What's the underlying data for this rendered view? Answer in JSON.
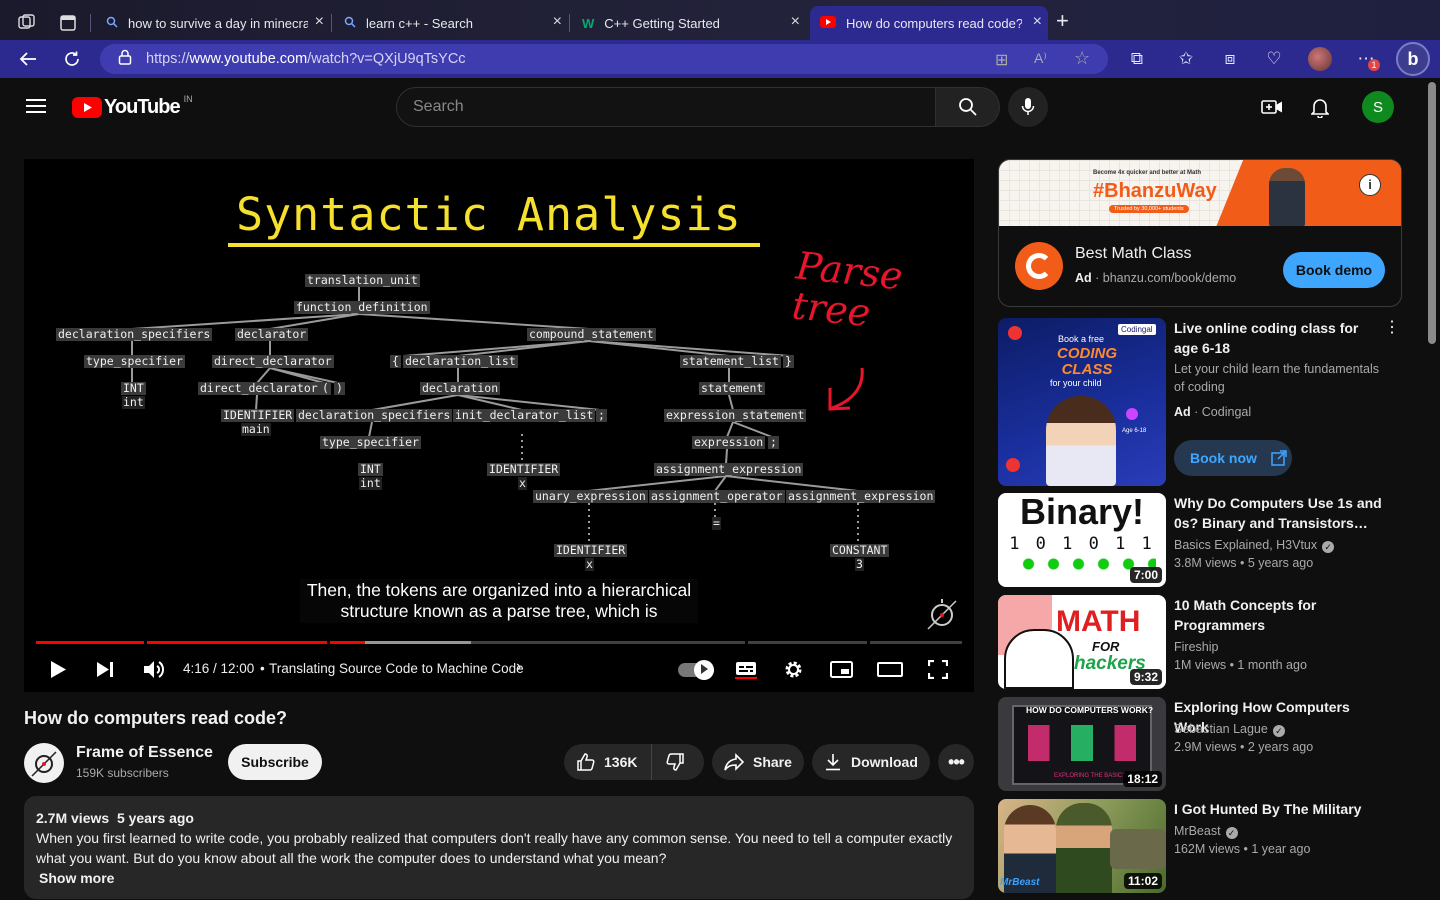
{
  "browser": {
    "tabs": [
      {
        "title": "how to survive a day in minecra",
        "icon": "search-icon"
      },
      {
        "title": "learn c++ - Search",
        "icon": "search-icon"
      },
      {
        "title": "C++ Getting Started",
        "icon": "w3schools-icon"
      },
      {
        "title": "How do computers read code?",
        "icon": "youtube-icon"
      }
    ],
    "new_tab": "+",
    "url_scheme": "https://",
    "url_host": "www.youtube.com",
    "url_path": "/watch?v=QXjU9qTsYCc",
    "notification_badge": "1"
  },
  "youtube": {
    "logo_text": "YouTube",
    "country": "IN",
    "search_placeholder": "Search",
    "avatar_letter": "S"
  },
  "video": {
    "slide_title": "Syntactic Analysis",
    "annotation": "Parse tree",
    "caption_line1": "Then, the tokens are organized into a hierarchical",
    "caption_line2": "structure known as a parse tree, which is",
    "time": "4:16 / 12:00",
    "chapter": "Translating Source Code to Machine Code",
    "progress_fraction": 0.355,
    "title": "How do computers read code?"
  },
  "tree_nodes": {
    "n1": "translation_unit",
    "n2": "function_definition",
    "n3": "declaration_specifiers",
    "n4": "declarator",
    "n5": "compound_statement",
    "n6": "type_specifier",
    "n7": "direct_declarator",
    "n8": "{",
    "n9": "declaration_list",
    "n10": "statement_list",
    "n11": "}",
    "n12": "INT",
    "n13": "int",
    "n14": "direct_declarator",
    "n15": "(",
    "n16": ")",
    "n17": "declaration",
    "n18": "statement",
    "n19": "IDENTIFIER",
    "n20": "main",
    "n21": "declaration_specifiers",
    "n22": "init_declarator_list",
    "n23": ";",
    "n24": "expression_statement",
    "n25": "type_specifier",
    "n26": "expression",
    "n27": ";",
    "n28": "INT",
    "n29": "int",
    "n30": "IDENTIFIER",
    "n31": "x",
    "n32": "assignment_expression",
    "n33": "unary_expression",
    "n34": "assignment_operator",
    "n35": "assignment_expression",
    "n36": "=",
    "n37": "IDENTIFIER",
    "n38": "x",
    "n39": "CONSTANT",
    "n40": "3"
  },
  "channel": {
    "name": "Frame of Essence",
    "subscribers": "159K subscribers",
    "subscribe": "Subscribe",
    "likes": "136K",
    "share": "Share",
    "download": "Download"
  },
  "description": {
    "views": "2.7M views",
    "age": "5 years ago",
    "text": "When you first learned to write code, you probably realized that computers don't really have any common sense. You need to tell a computer exactly what you want. But do you know about all the work the computer does to understand what you mean?",
    "show_more": "Show more"
  },
  "ad": {
    "banner_top": "Become 4x quicker and better at Math",
    "banner_brand": "#BhanzuWay",
    "banner_sub": "Trusted by 30,000+ students",
    "title": "Best Math Class",
    "ad_label": "Ad",
    "url": "bhanzu.com/book/demo",
    "button": "Book demo"
  },
  "recommendations": [
    {
      "title": "Live online coding class for age 6-18",
      "sub": "Let your child learn the fundamentals of coding",
      "ad": "Ad",
      "channel": "Codingal",
      "button": "Book now",
      "thumb_text1": "Book a free",
      "thumb_text2": "CODING CLASS",
      "thumb_text3": "for your child",
      "thumb_text4": "Age 6-18",
      "thumb_brand": "Codingal"
    },
    {
      "title": "Why Do Computers Use 1s and 0s? Binary and Transistors…",
      "channel": "Basics Explained, H3Vtux",
      "views": "3.8M views",
      "age": "5 years ago",
      "duration": "7:00",
      "thumb_text1": "Binary!",
      "thumb_text2": "1 0 1 0 1 1"
    },
    {
      "title": "10 Math Concepts for Programmers",
      "channel": "Fireship",
      "views": "1M views",
      "age": "1 month ago",
      "duration": "9:32",
      "thumb_text1": "MATH",
      "thumb_text2": "FOR",
      "thumb_text3": "hackers"
    },
    {
      "title": "Exploring How Computers Work",
      "channel": "Sebastian Lague",
      "views": "2.9M views",
      "age": "2 years ago",
      "duration": "18:12",
      "thumb_text1": "HOW DO COMPUTERS WORK?",
      "thumb_text2": "EXPLORING THE BASICS"
    },
    {
      "title": "I Got Hunted By The Military",
      "channel": "MrBeast",
      "views": "162M views",
      "age": "1 year ago",
      "duration": "11:02",
      "thumb_text1": "MrBeast"
    }
  ],
  "colors": {
    "yt_red": "#ff0000",
    "edge_purple": "#2d2a8f",
    "subscribe_bg": "#f1f1f1",
    "ad_button": "#3ea6ff",
    "slide_yellow": "#f5e02d",
    "annotation_red": "#e8152b",
    "avatar_green": "#0f8a1e"
  }
}
